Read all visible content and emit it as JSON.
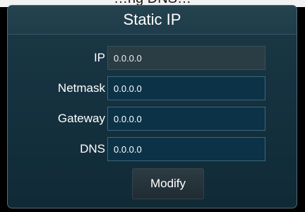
{
  "header_strip": {
    "text": "…ng DNS…"
  },
  "dialog": {
    "title": "Static IP",
    "fields": [
      {
        "label": "IP",
        "value": "0.0.0.0",
        "editable": false
      },
      {
        "label": "Netmask",
        "value": "0.0.0.0",
        "editable": true
      },
      {
        "label": "Gateway",
        "value": "0.0.0.0",
        "editable": true
      },
      {
        "label": "DNS",
        "value": "0.0.0.0",
        "editable": true
      }
    ],
    "modify_label": "Modify"
  },
  "colors": {
    "panel_background": "#163240",
    "field_background": "#0c3247",
    "readonly_field_background": "#2a3c44",
    "border": "#4e6b7a"
  }
}
